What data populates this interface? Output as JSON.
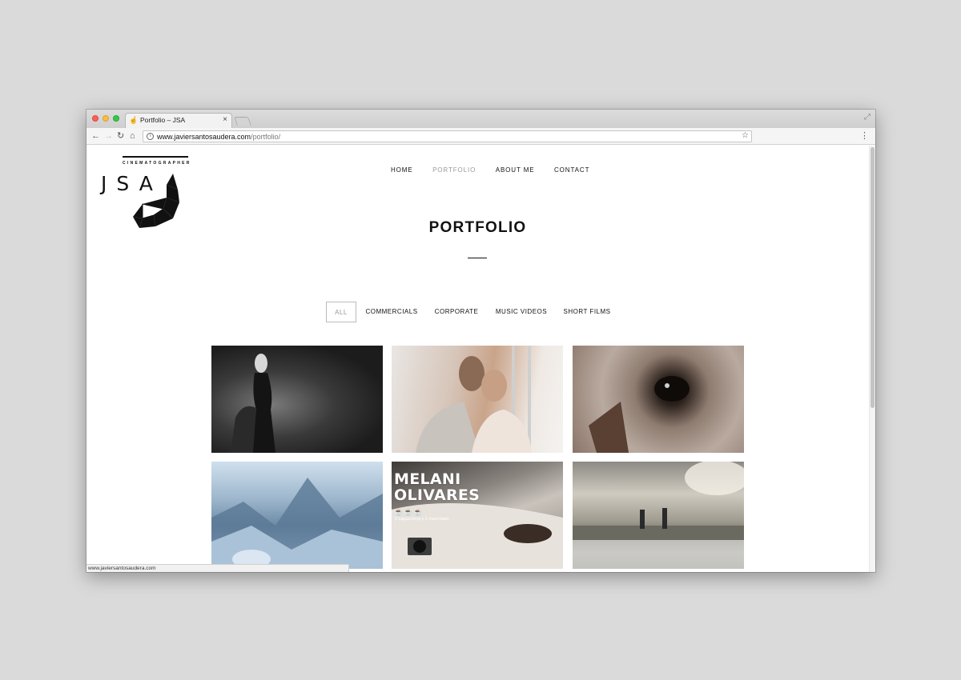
{
  "browser": {
    "tab_title": "Portfolio – JSA",
    "tab_close": "×",
    "url_host": "www.javiersantosaudera.com",
    "url_path": "/portfolio/",
    "status_url": "www.javiersantosaudera.com",
    "icons": {
      "back": "←",
      "forward": "→",
      "reload": "↻",
      "home": "⌂",
      "info": "i",
      "star": "☆",
      "menu": "⋮",
      "resize": "⤢",
      "favicon": "☝"
    }
  },
  "site": {
    "logo": {
      "subtitle": "CINEMATOGRAPHER",
      "mark": "JSA"
    },
    "nav": [
      {
        "label": "HOME"
      },
      {
        "label": "PORTFOLIO"
      },
      {
        "label": "ABOUT ME"
      },
      {
        "label": "CONTACT"
      }
    ],
    "page_title": "PORTFOLIO",
    "filters": [
      {
        "label": "ALL"
      },
      {
        "label": "COMMERCIALS"
      },
      {
        "label": "CORPORATE"
      },
      {
        "label": "MUSIC VIDEOS"
      },
      {
        "label": "SHORT FILMS"
      }
    ],
    "thumb5": {
      "title_line1": "MELANI",
      "title_line2": "OLIVARES",
      "cups": "☕☕☕",
      "caption": "2 capuccinos y 1 macchiato"
    }
  },
  "colors": {
    "accent_inactive": "#999999",
    "text": "#111111"
  }
}
